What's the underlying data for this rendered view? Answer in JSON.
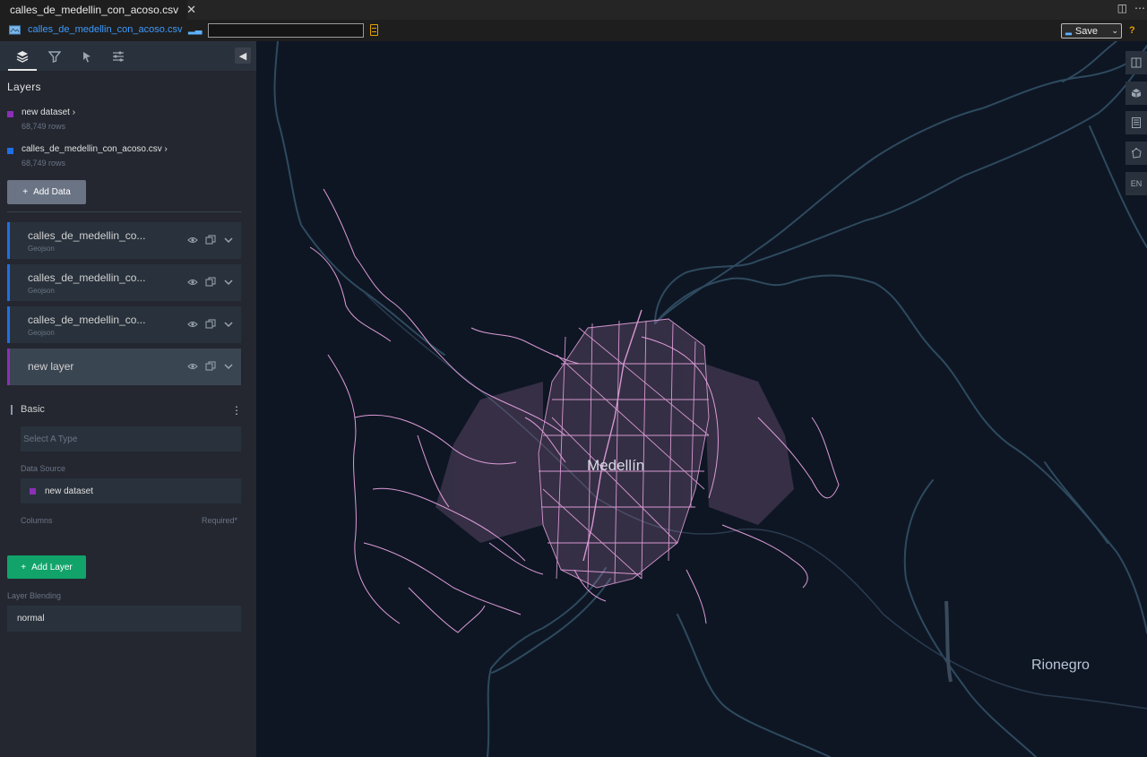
{
  "editor": {
    "tab_title": "calles_de_medellin_con_acoso.csv",
    "file_link": "calles_de_medellin_con_acoso.csv",
    "search_value": "",
    "save_label": "Save",
    "help_label": "?"
  },
  "sidebar": {
    "panel_tabs": [
      "layers-icon",
      "filter-icon",
      "interaction-icon",
      "settings-icon"
    ],
    "layers_heading": "Layers",
    "datasets": [
      {
        "name": "new dataset",
        "rows": "68,749 rows",
        "color": "#8b2fb8"
      },
      {
        "name": "calles_de_medellin_con_acoso.csv",
        "rows": "68,749 rows",
        "color": "#1f6fe6"
      }
    ],
    "add_data_label": "Add Data",
    "layers": [
      {
        "name": "calles_de_medellin_co...",
        "type": "Geojson",
        "color": "#1f6fe6"
      },
      {
        "name": "calles_de_medellin_co...",
        "type": "Geojson",
        "color": "#1f6fe6"
      },
      {
        "name": "calles_de_medellin_co...",
        "type": "Geojson",
        "color": "#1f6fe6"
      },
      {
        "name": "new layer",
        "type": "",
        "color": "#8b2fb8"
      }
    ],
    "basic_label": "Basic",
    "select_type_placeholder": "Select A Type",
    "data_source_label": "Data Source",
    "data_source_value": "new dataset",
    "columns_label": "Columns",
    "required_label": "Required*",
    "add_layer_label": "Add Layer",
    "layer_blending_label": "Layer Blending",
    "layer_blending_value": "normal"
  },
  "map": {
    "labels": {
      "medellin": "Medellín",
      "rionegro": "Rionegro"
    },
    "network_color": "#e8a3e0",
    "controls": [
      "split-map-icon",
      "3d-map-icon",
      "legend-icon",
      "draw-icon"
    ],
    "locale": "EN"
  }
}
